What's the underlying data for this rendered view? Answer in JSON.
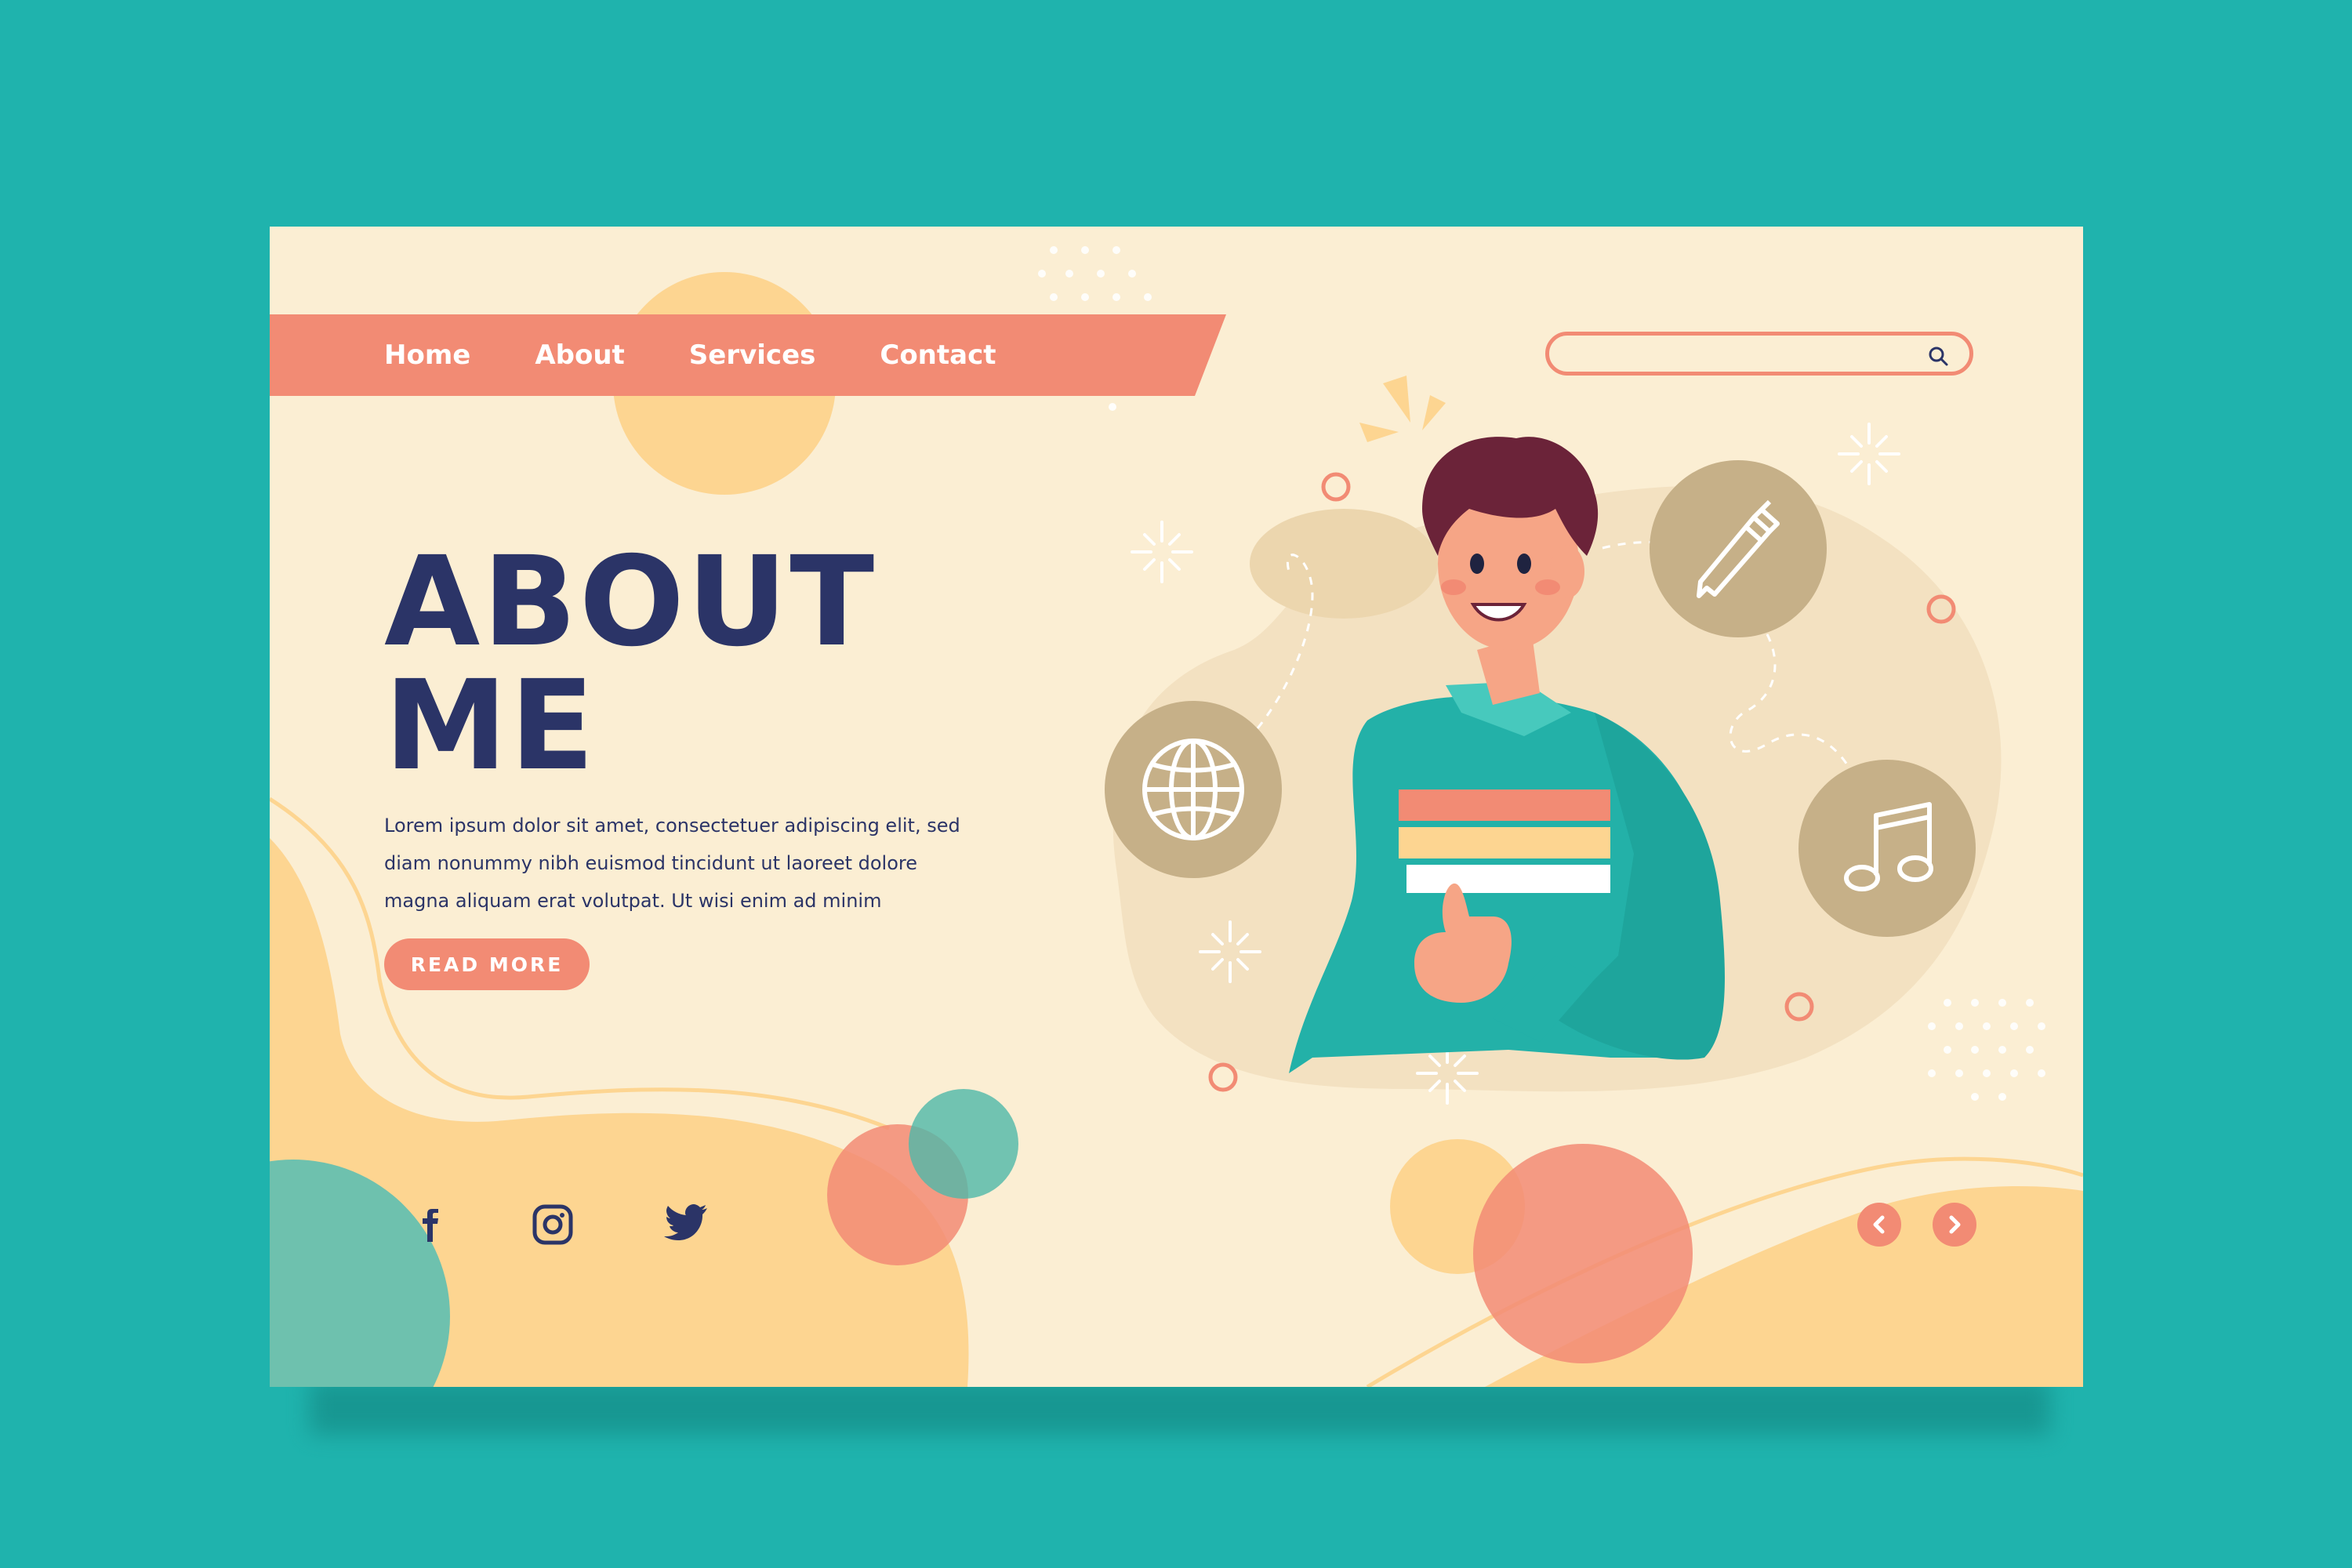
{
  "nav": {
    "items": [
      {
        "label": "Home"
      },
      {
        "label": "About"
      },
      {
        "label": "Services"
      },
      {
        "label": "Contact"
      }
    ]
  },
  "search": {
    "placeholder": "",
    "icon": "search-icon"
  },
  "hero": {
    "title_line1": "ABOUT",
    "title_line2": "ME",
    "body_line1": "Lorem ipsum dolor sit amet, consectetuer adipiscing elit, sed",
    "body_line2": "diam nonummy nibh euismod tincidunt ut laoreet dolore",
    "body_line3": "magna aliquam erat volutpat. Ut wisi enim ad minim",
    "button_label": "READ MORE"
  },
  "social": [
    {
      "icon": "facebook-icon"
    },
    {
      "icon": "instagram-icon"
    },
    {
      "icon": "twitter-icon"
    }
  ],
  "carousel": {
    "prev_icon": "chevron-left-icon",
    "next_icon": "chevron-right-icon"
  },
  "illustration": {
    "badges": [
      "pencil-icon",
      "globe-icon",
      "music-note-icon"
    ]
  },
  "colors": {
    "background": "#1fb3ad",
    "card": "#fbeed3",
    "accent": "#f28b74",
    "heading": "#2b3467",
    "yellow": "#fdd591",
    "teal": "#66c0b0",
    "badge": "#c6b088"
  }
}
